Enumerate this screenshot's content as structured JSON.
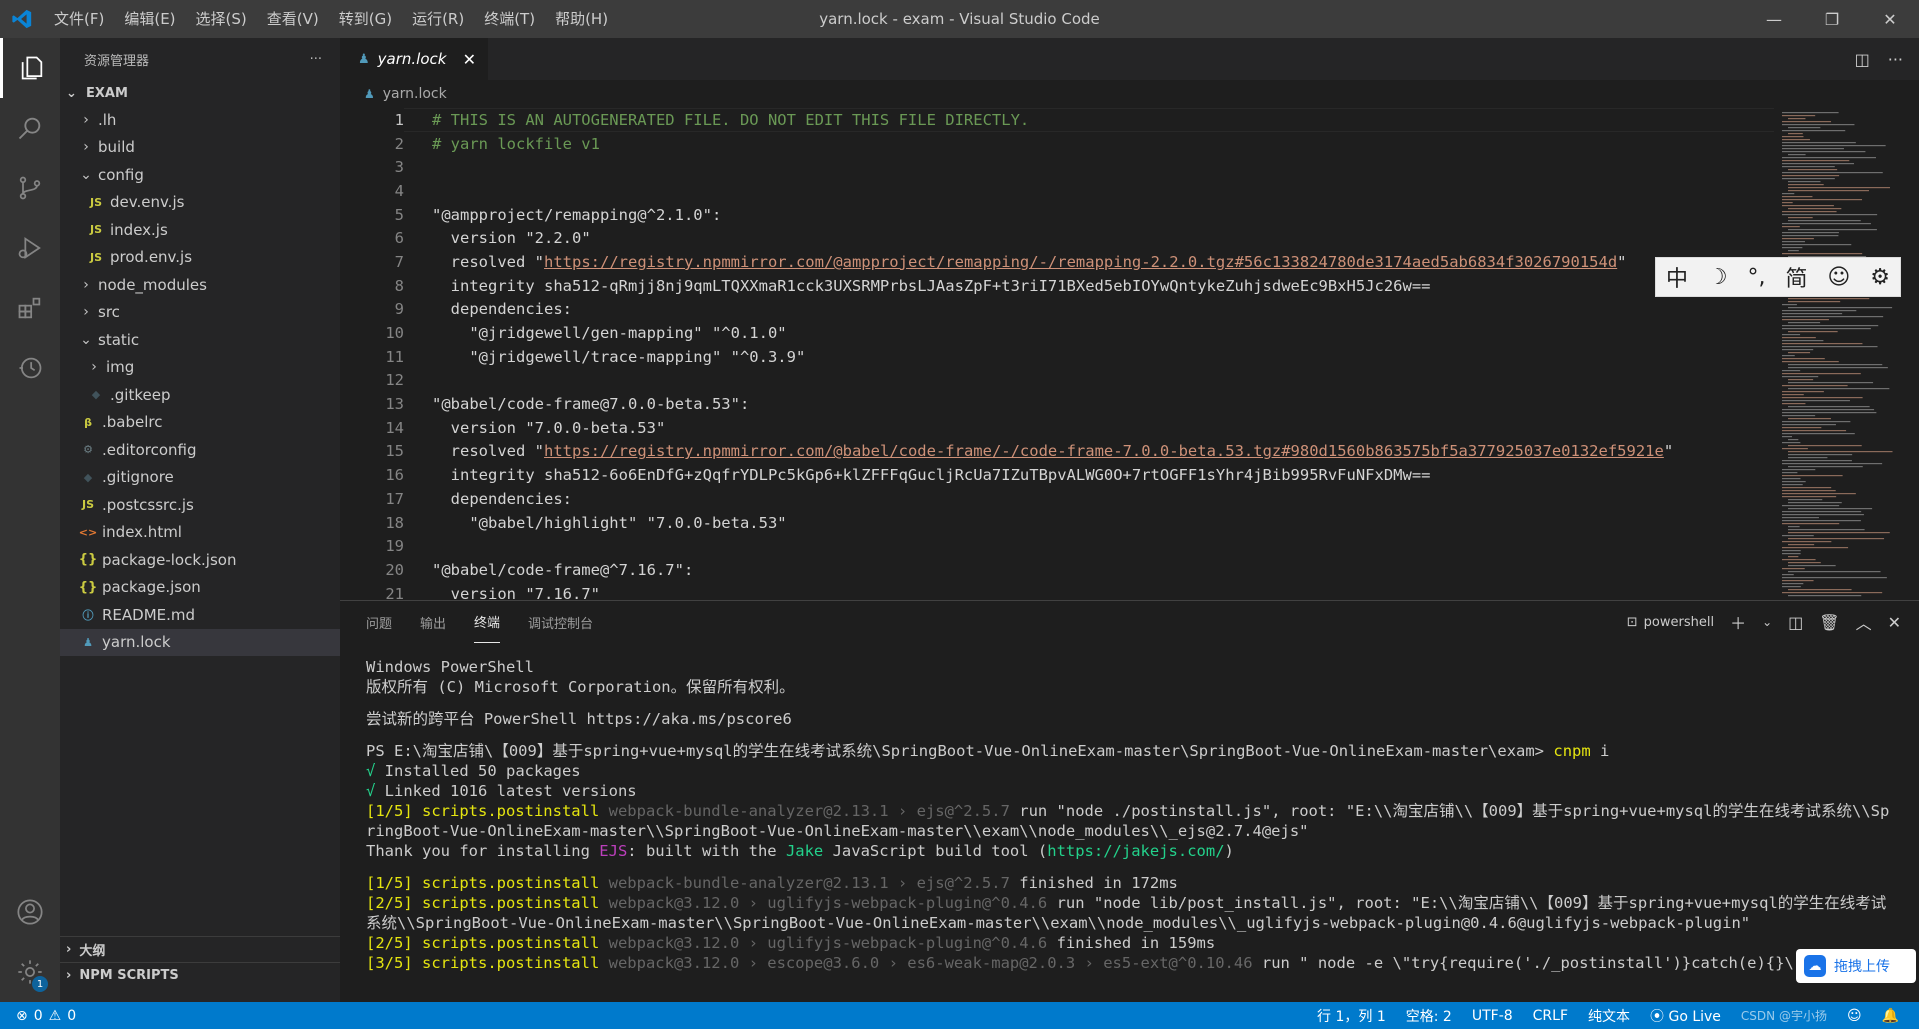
{
  "window": {
    "title": "yarn.lock - exam - Visual Studio Code",
    "menu": [
      "文件(F)",
      "编辑(E)",
      "选择(S)",
      "查看(V)",
      "转到(G)",
      "运行(R)",
      "终端(T)",
      "帮助(H)"
    ]
  },
  "sidebar": {
    "header": "资源管理器",
    "more": "···",
    "section": "EXAM",
    "items": [
      {
        "label": ".lh",
        "type": "folder",
        "expanded": false,
        "depth": 1
      },
      {
        "label": "build",
        "type": "folder",
        "expanded": false,
        "depth": 1
      },
      {
        "label": "config",
        "type": "folder",
        "expanded": true,
        "depth": 1
      },
      {
        "label": "dev.env.js",
        "type": "js",
        "depth": 2
      },
      {
        "label": "index.js",
        "type": "js",
        "depth": 2
      },
      {
        "label": "prod.env.js",
        "type": "js",
        "depth": 2
      },
      {
        "label": "node_modules",
        "type": "folder",
        "expanded": false,
        "depth": 1
      },
      {
        "label": "src",
        "type": "folder",
        "expanded": false,
        "depth": 1
      },
      {
        "label": "static",
        "type": "folder",
        "expanded": true,
        "depth": 1
      },
      {
        "label": "img",
        "type": "folder",
        "expanded": false,
        "depth": 2
      },
      {
        "label": ".gitkeep",
        "type": "git",
        "depth": 2
      },
      {
        "label": ".babelrc",
        "type": "babel",
        "depth": 1
      },
      {
        "label": ".editorconfig",
        "type": "gear",
        "depth": 1
      },
      {
        "label": ".gitignore",
        "type": "git",
        "depth": 1
      },
      {
        "label": ".postcssrc.js",
        "type": "js",
        "depth": 1
      },
      {
        "label": "index.html",
        "type": "html",
        "depth": 1
      },
      {
        "label": "package-lock.json",
        "type": "json",
        "depth": 1
      },
      {
        "label": "package.json",
        "type": "json",
        "depth": 1
      },
      {
        "label": "README.md",
        "type": "info",
        "depth": 1
      },
      {
        "label": "yarn.lock",
        "type": "yarn",
        "depth": 1,
        "selected": true
      }
    ],
    "outline": "大纲",
    "npm_scripts": "NPM SCRIPTS"
  },
  "editor": {
    "tab_label": "yarn.lock",
    "breadcrumb": "yarn.lock",
    "lines": [
      {
        "n": "1",
        "kind": "comment",
        "text": "# THIS IS AN AUTOGENERATED FILE. DO NOT EDIT THIS FILE DIRECTLY."
      },
      {
        "n": "2",
        "kind": "comment",
        "text": "# yarn lockfile v1"
      },
      {
        "n": "3",
        "kind": "plain",
        "text": ""
      },
      {
        "n": "4",
        "kind": "plain",
        "text": ""
      },
      {
        "n": "5",
        "kind": "plain",
        "text": "\"@ampproject/remapping@^2.1.0\":"
      },
      {
        "n": "6",
        "kind": "kv",
        "indent": "  ",
        "key": "version ",
        "value": "\"2.2.0\""
      },
      {
        "n": "7",
        "kind": "url",
        "indent": "  ",
        "key": "resolved ",
        "quote": "\"",
        "value": "https://registry.npmmirror.com/@ampproject/remapping/-/remapping-2.2.0.tgz#56c133824780de3174aed5ab6834f3026790154d"
      },
      {
        "n": "8",
        "kind": "plain",
        "text": "  integrity sha512-qRmjj8nj9qmLTQXXmaR1cck3UXSRMPrbsLJAasZpF+t3riI71BXed5ebIOYwQntykeZuhjsdweEc9BxH5Jc26w=="
      },
      {
        "n": "9",
        "kind": "plain",
        "text": "  dependencies:"
      },
      {
        "n": "10",
        "kind": "kv",
        "indent": "    ",
        "key": "\"@jridgewell/gen-mapping\" ",
        "value": "\"^0.1.0\""
      },
      {
        "n": "11",
        "kind": "kv",
        "indent": "    ",
        "key": "\"@jridgewell/trace-mapping\" ",
        "value": "\"^0.3.9\""
      },
      {
        "n": "12",
        "kind": "plain",
        "text": ""
      },
      {
        "n": "13",
        "kind": "plain",
        "text": "\"@babel/code-frame@7.0.0-beta.53\":"
      },
      {
        "n": "14",
        "kind": "kv",
        "indent": "  ",
        "key": "version ",
        "value": "\"7.0.0-beta.53\""
      },
      {
        "n": "15",
        "kind": "url",
        "indent": "  ",
        "key": "resolved ",
        "quote": "\"",
        "value": "https://registry.npmmirror.com/@babel/code-frame/-/code-frame-7.0.0-beta.53.tgz#980d1560b863575bf5a377925037e0132ef5921e"
      },
      {
        "n": "16",
        "kind": "plain",
        "text": "  integrity sha512-6o6EnDfG+zQqfrYDLPc5kGp6+klZFFFqGucljRcUa7IZuTBpvALWG0O+7rtOGFF1sYhr4jBib995RvFuNFxDMw=="
      },
      {
        "n": "17",
        "kind": "plain",
        "text": "  dependencies:"
      },
      {
        "n": "18",
        "kind": "kv",
        "indent": "    ",
        "key": "\"@babel/highlight\" ",
        "value": "\"7.0.0-beta.53\""
      },
      {
        "n": "19",
        "kind": "plain",
        "text": ""
      },
      {
        "n": "20",
        "kind": "plain",
        "text": "\"@babel/code-frame@^7.16.7\":"
      },
      {
        "n": "21",
        "kind": "kv",
        "indent": "  ",
        "key": "version ",
        "value": "\"7.16.7\""
      }
    ],
    "ime_toolbar": [
      "中",
      "☽",
      "°,",
      "简",
      "☺",
      "⚙"
    ]
  },
  "panel": {
    "tabs": [
      "问题",
      "输出",
      "终端",
      "调试控制台"
    ],
    "active_tab": "终端",
    "shell": "powershell",
    "terminal_lines": [
      [
        {
          "t": "Windows PowerShell"
        }
      ],
      [
        {
          "t": "版权所有 (C) Microsoft Corporation。保留所有权利。"
        }
      ],
      [
        {
          "t": ""
        }
      ],
      [
        {
          "t": "尝试新的跨平台 PowerShell https://aka.ms/pscore6"
        }
      ],
      [
        {
          "t": ""
        }
      ],
      [
        {
          "t": "PS E:\\淘宝店铺\\【009】基于spring+vue+mysql的学生在线考试系统\\SpringBoot-Vue-OnlineExam-master\\SpringBoot-Vue-OnlineExam-master\\exam> "
        },
        {
          "t": "cnpm",
          "c": "yellow"
        },
        {
          "t": " i"
        }
      ],
      [
        {
          "t": "√",
          "c": "green"
        },
        {
          "t": " Installed 50 packages"
        }
      ],
      [
        {
          "t": "√",
          "c": "green"
        },
        {
          "t": " Linked 1016 latest versions"
        }
      ],
      [
        {
          "t": "[1/5] scripts.postinstall",
          "c": "yellow"
        },
        {
          "t": " webpack-bundle-analyzer@2.13.1 › ejs@^2.5.7 ",
          "c": "gray"
        },
        {
          "t": "run \"node ./postinstall.js\", root: \"E:\\\\淘宝店铺\\\\【009】基于spring+vue+mysql的学生在线考试系统\\\\Sp"
        }
      ],
      [
        {
          "t": "ringBoot-Vue-OnlineExam-master\\\\SpringBoot-Vue-OnlineExam-master\\\\exam\\\\node_modules\\\\_ejs@2.7.4@ejs\""
        }
      ],
      [
        {
          "t": "Thank you for installing "
        },
        {
          "t": "EJS",
          "c": "mag"
        },
        {
          "t": ": built with the "
        },
        {
          "t": "Jake",
          "c": "green"
        },
        {
          "t": " JavaScript build tool ("
        },
        {
          "t": "https://jakejs.com/",
          "c": "green"
        },
        {
          "t": ")"
        }
      ],
      [
        {
          "t": ""
        }
      ],
      [
        {
          "t": "[1/5] scripts.postinstall",
          "c": "yellow"
        },
        {
          "t": " webpack-bundle-analyzer@2.13.1 › ejs@^2.5.7 ",
          "c": "gray"
        },
        {
          "t": "finished in 172ms"
        }
      ],
      [
        {
          "t": "[2/5] scripts.postinstall",
          "c": "yellow"
        },
        {
          "t": " webpack@3.12.0 › uglifyjs-webpack-plugin@^0.4.6 ",
          "c": "gray"
        },
        {
          "t": "run \"node lib/post_install.js\", root: \"E:\\\\淘宝店铺\\\\【009】基于spring+vue+mysql的学生在线考试"
        }
      ],
      [
        {
          "t": "系统\\\\SpringBoot-Vue-OnlineExam-master\\\\SpringBoot-Vue-OnlineExam-master\\\\exam\\\\node_modules\\\\_uglifyjs-webpack-plugin@0.4.6@uglifyjs-webpack-plugin\""
        }
      ],
      [
        {
          "t": "[2/5] scripts.postinstall",
          "c": "yellow"
        },
        {
          "t": " webpack@3.12.0 › uglifyjs-webpack-plugin@^0.4.6 ",
          "c": "gray"
        },
        {
          "t": "finished in 159ms"
        }
      ],
      [
        {
          "t": "[3/5] scripts.postinstall",
          "c": "yellow"
        },
        {
          "t": " webpack@3.12.0 › escope@3.6.0 › es6-weak-map@2.0.3 › es5-ext@^0.10.46 ",
          "c": "gray"
        },
        {
          "t": "run \" node -e \\\"try{require('./_postinstall')}catch(e){}\\\" || exit 0\", ro"
        }
      ]
    ],
    "upload_label": "拖拽上传"
  },
  "statusbar": {
    "errors": "0",
    "warnings": "0",
    "position": "行 1，列 1",
    "spaces": "空格: 2",
    "encoding": "UTF-8",
    "eol": "CRLF",
    "language": "纯文本",
    "golive": "Go Live",
    "watermark": "CSDN @宇小扬"
  },
  "colors": {
    "accent": "#007acc",
    "titlebar": "#3c3c3c",
    "activitybar": "#333333",
    "sidebar": "#252526",
    "editor": "#1e1e1e"
  }
}
